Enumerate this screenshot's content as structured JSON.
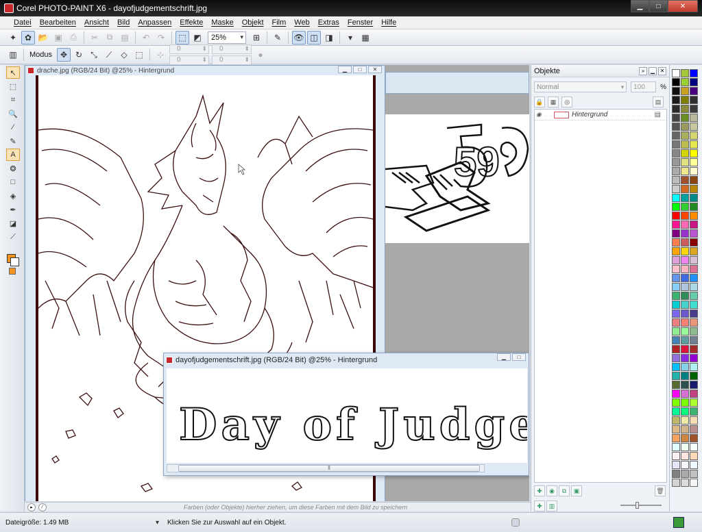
{
  "window": {
    "title": "Corel PHOTO-PAINT X6 - dayofjudgementschrift.jpg",
    "min": "▁",
    "max": "□",
    "close": "✕"
  },
  "menu": [
    "Datei",
    "Bearbeiten",
    "Ansicht",
    "Bild",
    "Anpassen",
    "Effekte",
    "Maske",
    "Objekt",
    "Film",
    "Web",
    "Extras",
    "Fenster",
    "Hilfe"
  ],
  "toolbar1": {
    "zoom": "25%"
  },
  "toolbar2": {
    "modus_label": "Modus",
    "fields": [
      "0",
      "0",
      "0",
      "0"
    ]
  },
  "documents": {
    "drache": {
      "title": "drache.jpg (RGB/24 Bit) @25% - Hintergrund"
    },
    "dayof": {
      "title": "dayofjudgementschrift.jpg (RGB/24 Bit) @25% - Hintergrund",
      "artwork_text": "Day of Judgeme"
    },
    "logo": {
      "artwork_text": "59"
    }
  },
  "docker": {
    "title": "Objekte",
    "mode": "Normal",
    "opacity": "100",
    "opacity_unit": "%",
    "objects": [
      {
        "name": "Hintergrund"
      }
    ]
  },
  "colorbar": {
    "hint": "Farben (oder Objekte) hierher ziehen, um diese Farben mit dem Bild zu speichern"
  },
  "status": {
    "filesize": "Dateigröße: 1.49 MB",
    "message": "Klicken Sie zur Auswahl auf ein Objekt."
  },
  "palette": [
    "#ffffff",
    "#a4c639",
    "#0000ff",
    "#000000",
    "#9acd32",
    "#000080",
    "#111111",
    "#c8a020",
    "#4b0082",
    "#1a1a1a",
    "#808000",
    "#2e2e2e",
    "#2a2a2a",
    "#8b8b3a",
    "#3a3a3a",
    "#444444",
    "#6b8e23",
    "#b8b89a",
    "#555555",
    "#9a9a60",
    "#c7c7a0",
    "#666666",
    "#a8b060",
    "#d6d670",
    "#777777",
    "#bcbc50",
    "#e6e650",
    "#888888",
    "#d4d400",
    "#ffff00",
    "#999999",
    "#e0e080",
    "#ffff99",
    "#aaaaaa",
    "#f0e68c",
    "#fffacd",
    "#bbbbbb",
    "#a0522d",
    "#8b4513",
    "#cccccc",
    "#d2691e",
    "#b8860b",
    "#00ffff",
    "#00a0a0",
    "#008b8b",
    "#00ff00",
    "#32cd32",
    "#228b22",
    "#ff0000",
    "#ff4500",
    "#ff8c00",
    "#ff1493",
    "#ff69b4",
    "#c71585",
    "#800080",
    "#9932cc",
    "#ba55d3",
    "#ff7f50",
    "#cd5c5c",
    "#8b0000",
    "#ffa500",
    "#ffd700",
    "#daa520",
    "#dda0dd",
    "#ee82ee",
    "#d8bfd8",
    "#ffc0cb",
    "#ffb6c1",
    "#db7093",
    "#6495ed",
    "#4169e1",
    "#1e90ff",
    "#87cefa",
    "#b0c4de",
    "#add8e6",
    "#3cb371",
    "#2e8b57",
    "#66cdaa",
    "#00ced1",
    "#48d1cc",
    "#40e0d0",
    "#7b68ee",
    "#6a5acd",
    "#483d8b",
    "#f08080",
    "#fa8072",
    "#e9967a",
    "#90ee90",
    "#98fb98",
    "#8fbc8f",
    "#4682b4",
    "#5f9ea0",
    "#708090",
    "#b22222",
    "#dc143c",
    "#a52a2a",
    "#9370db",
    "#8a2be2",
    "#9400d3",
    "#00bfff",
    "#87ceeb",
    "#afeeee",
    "#20b2aa",
    "#008080",
    "#006400",
    "#556b2f",
    "#2f4f4f",
    "#191970",
    "#ff00ff",
    "#da70d6",
    "#c04080",
    "#7fff00",
    "#7cfc00",
    "#adff2f",
    "#00fa9a",
    "#00ff7f",
    "#3cb371",
    "#bdb76b",
    "#eee8aa",
    "#f5deb3",
    "#deb887",
    "#d2b48c",
    "#bc8f8f",
    "#f4a460",
    "#cd853f",
    "#a0522d",
    "#e0ffff",
    "#f0fff0",
    "#f5fffa",
    "#fff0f5",
    "#ffe4e1",
    "#ffdab9",
    "#e6e6fa",
    "#f8f8ff",
    "#f0f8ff",
    "#808080",
    "#a9a9a9",
    "#c0c0c0",
    "#d3d3d3",
    "#dcdcdc",
    "#f5f5f5"
  ]
}
